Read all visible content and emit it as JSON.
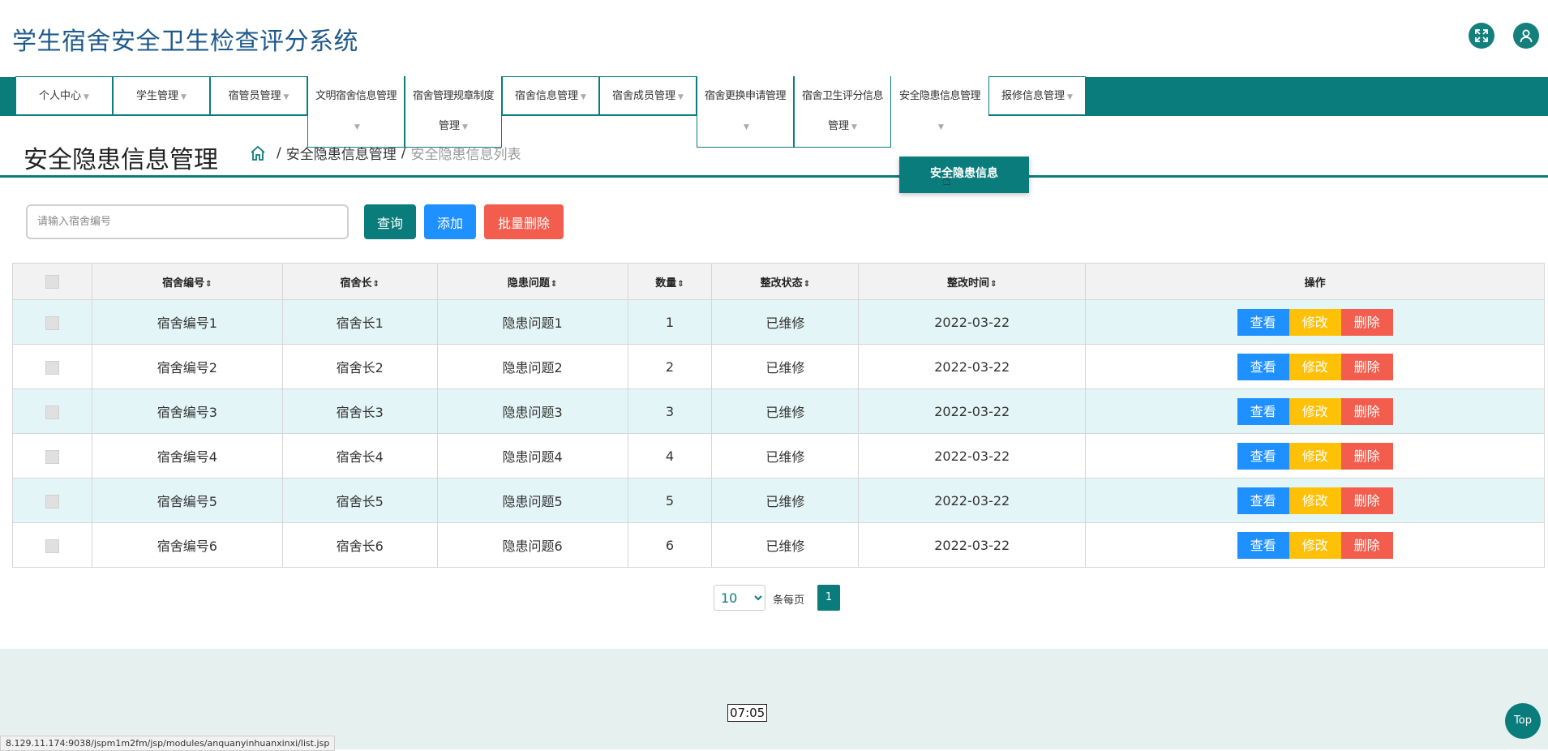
{
  "header": {
    "title": "学生宿舍安全卫生检查评分系统",
    "icons": [
      "expand-icon",
      "user-icon"
    ]
  },
  "nav": {
    "items": [
      {
        "label": "个人中心"
      },
      {
        "label": "学生管理"
      },
      {
        "label": "宿管员管理"
      },
      {
        "label": "文明宿舍信息管理",
        "line2": ""
      },
      {
        "label": "宿舍管理规章制度",
        "line2": "管理"
      },
      {
        "label": "宿舍信息管理"
      },
      {
        "label": "宿舍成员管理"
      },
      {
        "label": "宿舍更换申请管理",
        "line2": ""
      },
      {
        "label": "宿舍卫生评分信息",
        "line2": "管理"
      },
      {
        "label": "安全隐患信息管理",
        "line2": ""
      },
      {
        "label": "报修信息管理"
      }
    ],
    "dropdown_item": "安全隐患信息"
  },
  "page": {
    "title": "安全隐患信息管理",
    "breadcrumb_current": "安全隐患信息管理",
    "breadcrumb_sep": "/",
    "breadcrumb_list": "安全隐患信息列表"
  },
  "toolbar": {
    "search_placeholder": "请输入宿舍编号",
    "query_label": "查询",
    "add_label": "添加",
    "batch_delete_label": "批量删除"
  },
  "table": {
    "headers": [
      "宿舍编号",
      "宿舍长",
      "隐患问题",
      "数量",
      "整改状态",
      "整改时间",
      "操作"
    ],
    "rows": [
      [
        "宿舍编号1",
        "宿舍长1",
        "隐患问题1",
        "1",
        "已维修",
        "2022-03-22"
      ],
      [
        "宿舍编号2",
        "宿舍长2",
        "隐患问题2",
        "2",
        "已维修",
        "2022-03-22"
      ],
      [
        "宿舍编号3",
        "宿舍长3",
        "隐患问题3",
        "3",
        "已维修",
        "2022-03-22"
      ],
      [
        "宿舍编号4",
        "宿舍长4",
        "隐患问题4",
        "4",
        "已维修",
        "2022-03-22"
      ],
      [
        "宿舍编号5",
        "宿舍长5",
        "隐患问题5",
        "5",
        "已维修",
        "2022-03-22"
      ],
      [
        "宿舍编号6",
        "宿舍长6",
        "隐患问题6",
        "6",
        "已维修",
        "2022-03-22"
      ]
    ],
    "actions": {
      "view": "查看",
      "edit": "修改",
      "delete": "删除"
    }
  },
  "pagination": {
    "page_size": "10",
    "per_page_label": "条每页",
    "current_page": "1"
  },
  "footer": {
    "time": "07:05",
    "status_url": "8.129.11.174:9038/jspm1m2fm/jsp/modules/anquanyinhuanxinxi/list.jsp",
    "top_label": "Top"
  },
  "colors": {
    "primary": "#0a7c7c",
    "title": "#1f5a8c",
    "view": "#1e90ff",
    "edit": "#ffc107",
    "delete": "#f25d4d"
  }
}
